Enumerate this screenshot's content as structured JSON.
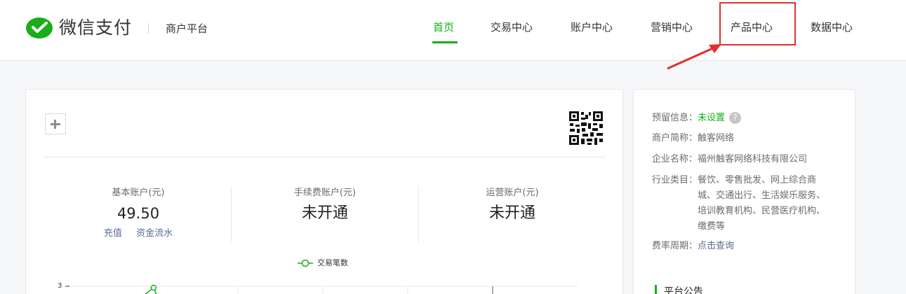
{
  "header": {
    "brand": "微信支付",
    "platform": "商户平台",
    "nav": [
      {
        "label": "首页",
        "active": true
      },
      {
        "label": "交易中心"
      },
      {
        "label": "账户中心"
      },
      {
        "label": "营销中心"
      },
      {
        "label": "产品中心",
        "highlighted": true
      },
      {
        "label": "数据中心"
      }
    ]
  },
  "accounts": [
    {
      "label": "基本账户(元)",
      "value": "49.50",
      "links": [
        "充值",
        "资金流水"
      ]
    },
    {
      "label": "手续费账户(元)",
      "value": "未开通"
    },
    {
      "label": "运营账户(元)",
      "value": "未开通"
    }
  ],
  "chart_data": {
    "type": "line",
    "series": [
      {
        "name": "交易笔数"
      }
    ],
    "yticks": [
      "3"
    ]
  },
  "side": {
    "reserved_label": "预留信息：",
    "reserved_value": "未设置",
    "help_glyph": "?",
    "short_name_label": "商户简称：",
    "short_name_value": "触客网络",
    "company_label": "企业名称：",
    "company_value": "福州触客网络科技有限公司",
    "industry_label": "行业类目：",
    "industry_value": "餐饮、零售批发、网上综合商城、交通出行、生活娱乐服务、培训教育机构、民营医疗机构、缴费等",
    "fee_label": "费率周期：",
    "fee_value": "点击查询",
    "notice_title": "平台公告"
  },
  "colors": {
    "accent": "#1aad19",
    "link": "#576b95",
    "highlight": "#e0302f"
  }
}
